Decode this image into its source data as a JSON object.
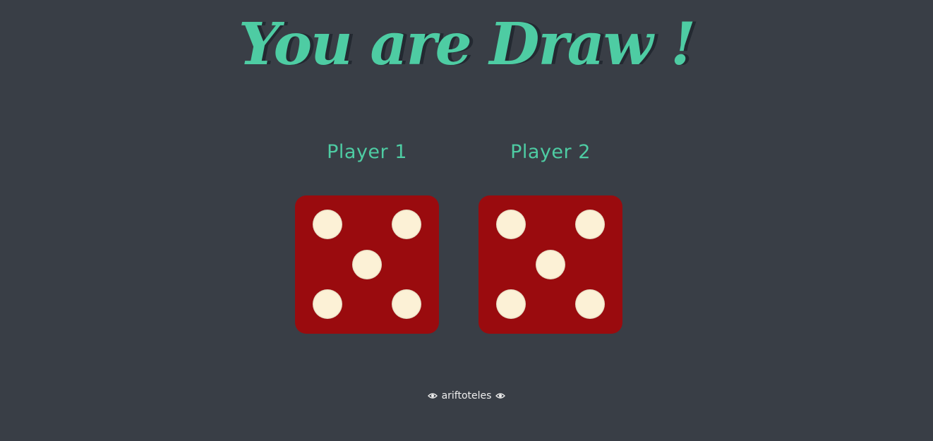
{
  "header": {
    "title": "You are Draw !"
  },
  "players": [
    {
      "label": "Player 1",
      "die_value": 5
    },
    {
      "label": "Player 2",
      "die_value": 5
    }
  ],
  "footer": {
    "author": "ariftoteles",
    "icon_left": "eye-icon",
    "icon_right": "eye-icon"
  },
  "colors": {
    "background": "#393E46",
    "accent": "#4ECCA3",
    "title_shadow": "#232931",
    "die": "#9A0B0E",
    "pip": "#FCF1D6",
    "footer_text": "#EEEEEE"
  }
}
